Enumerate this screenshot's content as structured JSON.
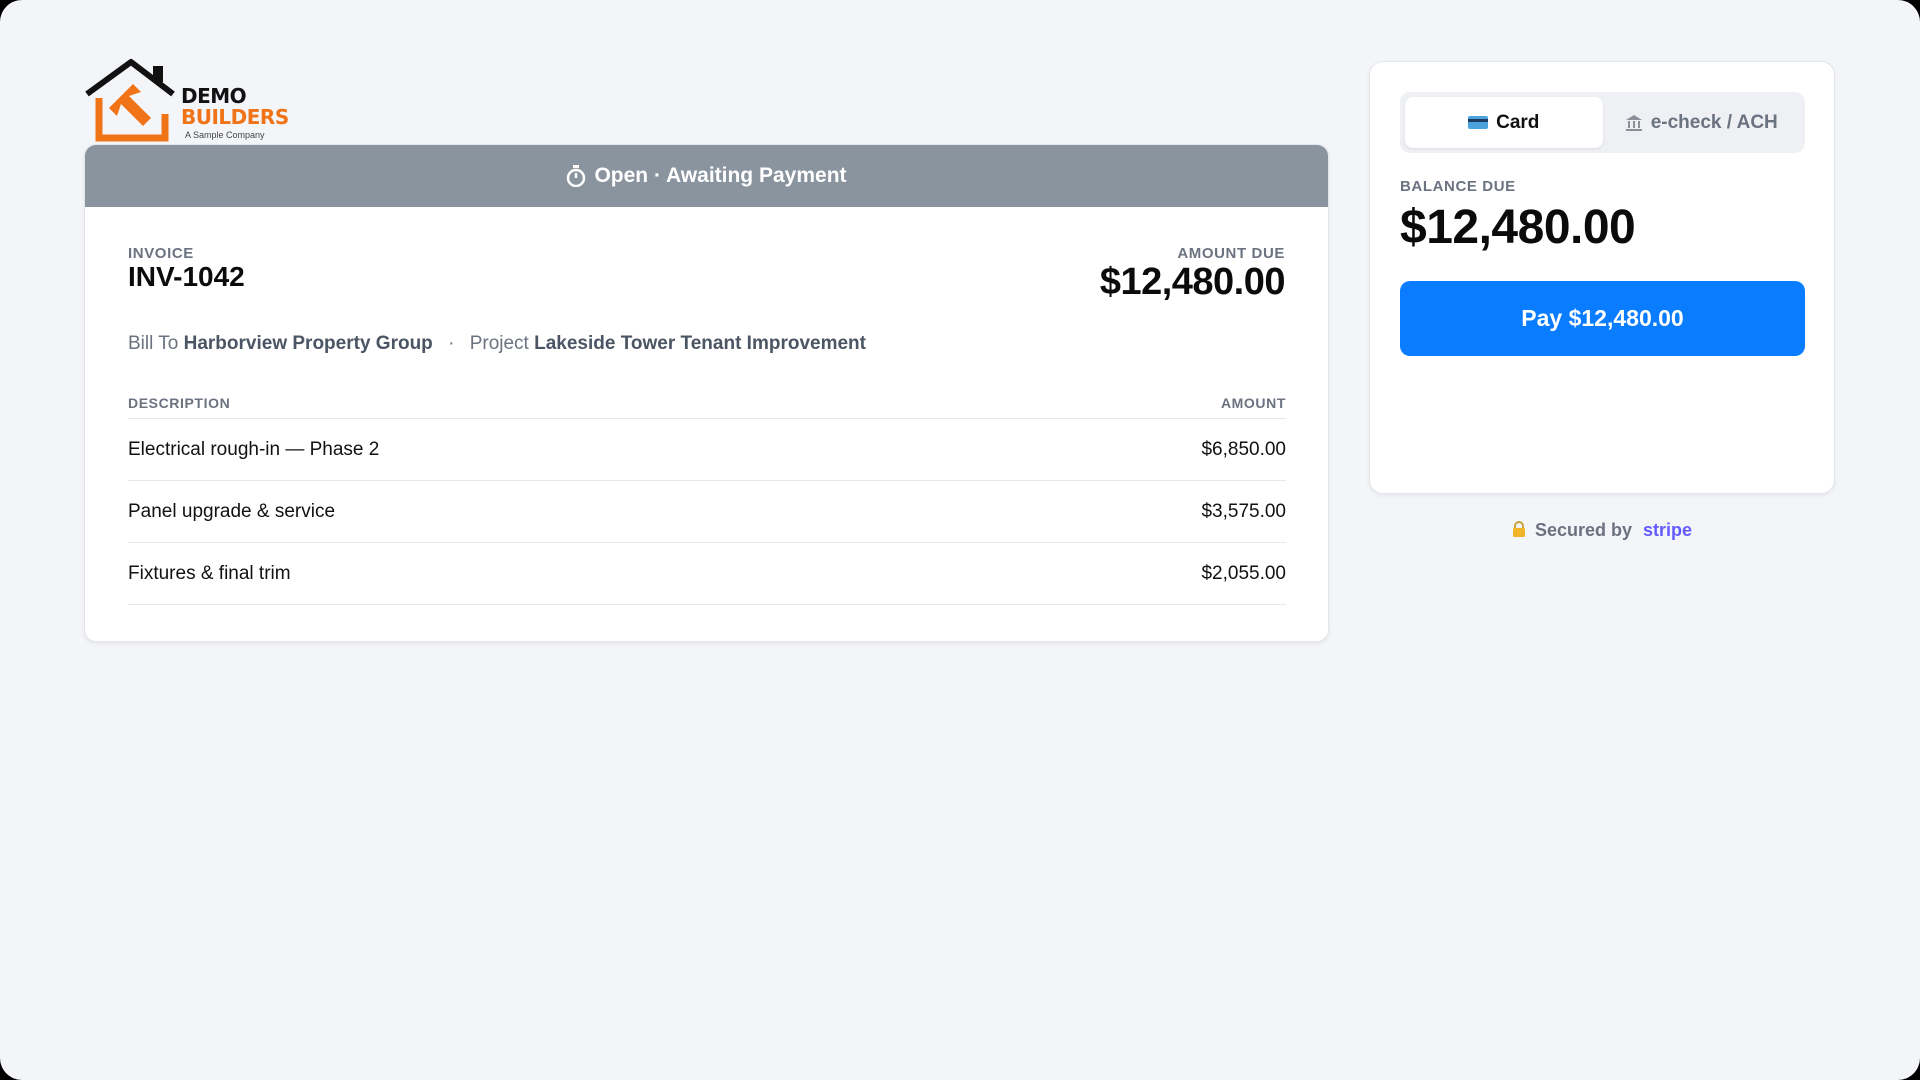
{
  "company": {
    "logo_word1": "DEMO",
    "logo_word2": "BUILDERS",
    "tagline": "A Sample Company",
    "brand_orange": "#f07417"
  },
  "status": {
    "icon": "stopwatch-icon",
    "text": "Open · Awaiting Payment",
    "color": "#8a949f"
  },
  "invoice": {
    "label": "INVOICE",
    "number": "INV-1042",
    "amount_due_label": "AMOUNT DUE",
    "amount_due": "$12,480.00",
    "bill_to_label": "Bill To",
    "bill_to": "Harborview Property Group",
    "separator": "·",
    "project_label": "Project",
    "project": "Lakeside Tower Tenant Improvement"
  },
  "table": {
    "headers": [
      "DESCRIPTION",
      "AMOUNT"
    ],
    "rows": [
      {
        "description": "Electrical rough-in — Phase 2",
        "amount": "$6,850.00"
      },
      {
        "description": "Panel upgrade & service",
        "amount": "$3,575.00"
      },
      {
        "description": "Fixtures & final trim",
        "amount": "$2,055.00"
      }
    ]
  },
  "payment": {
    "tabs": [
      {
        "label": "Card",
        "icon": "credit-card-icon",
        "active": true
      },
      {
        "label": "e-check / ACH",
        "icon": "bank-icon",
        "active": false
      }
    ],
    "balance_label": "BALANCE DUE",
    "balance": "$12,480.00",
    "pay_button": "Pay $12,480.00",
    "accent": "#0a7cff"
  },
  "footer": {
    "secured_by": "Secured by",
    "provider": "stripe",
    "lock_icon": "lock-icon"
  }
}
